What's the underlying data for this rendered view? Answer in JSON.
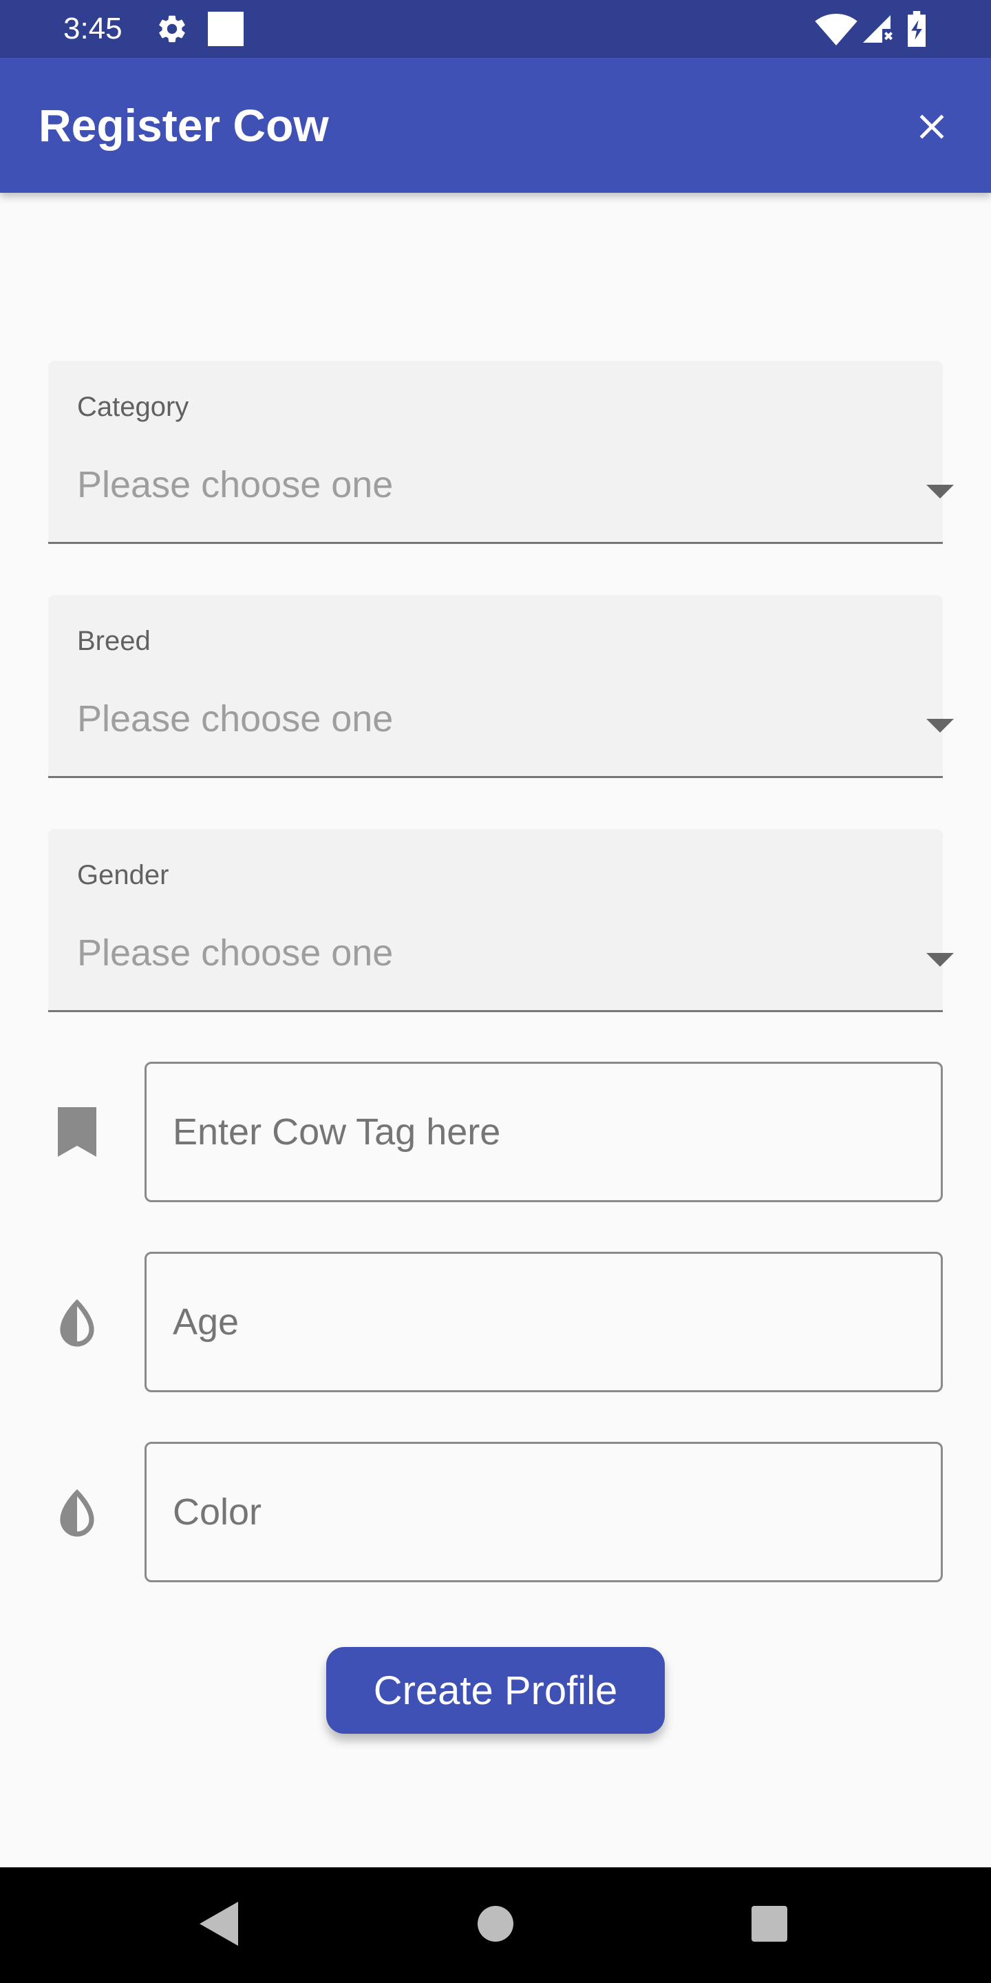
{
  "status_bar": {
    "time": "3:45",
    "icons": [
      "gear-icon",
      "notification-square-icon",
      "wifi-icon",
      "signal-icon",
      "battery-charging-icon"
    ]
  },
  "app_bar": {
    "title": "Register Cow",
    "close_icon": "close-icon",
    "color": "#3f51b5"
  },
  "form": {
    "category": {
      "label": "Category",
      "value": "Please choose one"
    },
    "breed": {
      "label": "Breed",
      "value": "Please choose one"
    },
    "gender": {
      "label": "Gender",
      "value": "Please choose one"
    },
    "cow_tag": {
      "icon": "bookmark-icon",
      "placeholder": "Enter Cow Tag here",
      "value": ""
    },
    "age": {
      "icon": "drop-icon",
      "placeholder": "Age",
      "value": ""
    },
    "color": {
      "icon": "drop-icon",
      "placeholder": "Color",
      "value": ""
    },
    "submit_label": "Create Profile"
  },
  "nav_bar": {
    "icons": [
      "back-icon",
      "home-icon",
      "recents-icon"
    ]
  },
  "colors": {
    "accent": "#3f51b5",
    "status_bar": "#303f8f",
    "background": "#fafafa"
  }
}
